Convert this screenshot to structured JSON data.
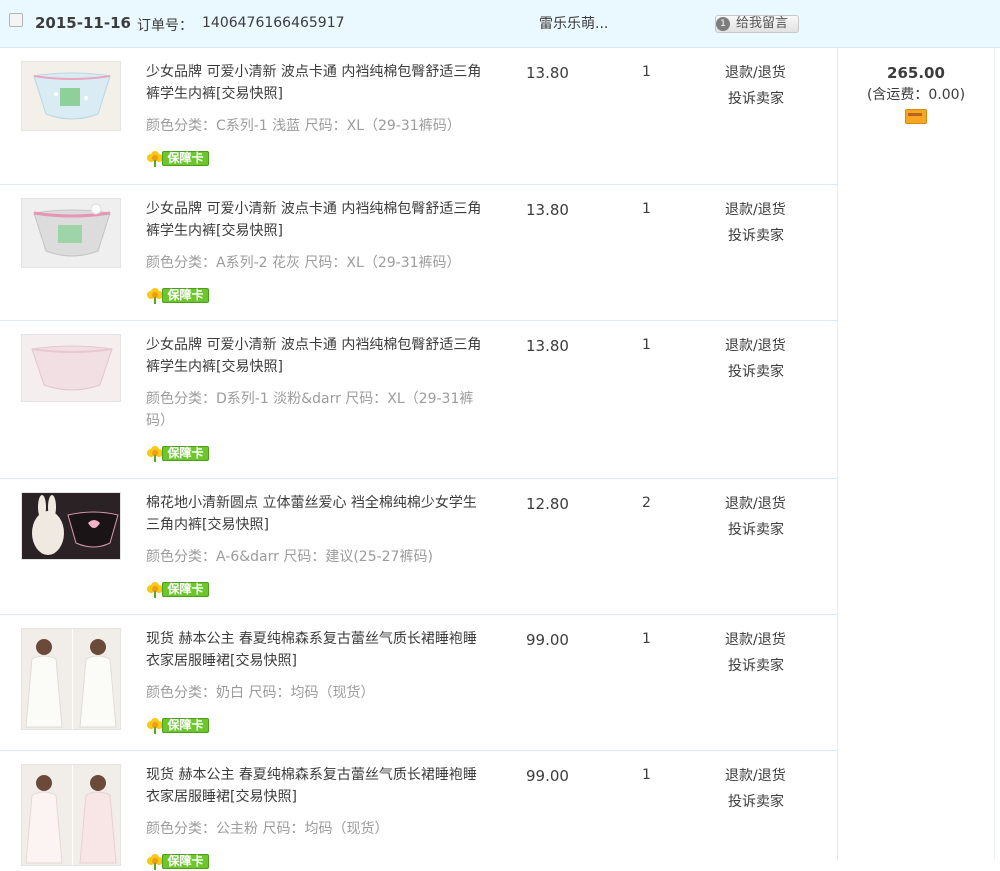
{
  "order": {
    "date": "2015-11-16",
    "number_label": "订单号：",
    "number": "1406476166465917",
    "shop": "雷乐乐萌...",
    "message_icon_text": "1",
    "message_button": "给我留言"
  },
  "items": [
    {
      "title": "少女品牌 可爱小清新 波点卡通 内裆纯棉包臀舒适三角裤学生内裤[交易快照]",
      "spec": "颜色分类：C系列-1 浅蓝  尺码：XL（29-31裤码）",
      "badge": "保障卡",
      "price": "13.80",
      "qty": "1",
      "action1": "退款/退货",
      "action2": "投诉卖家"
    },
    {
      "title": "少女品牌 可爱小清新 波点卡通 内裆纯棉包臀舒适三角裤学生内裤[交易快照]",
      "spec": "颜色分类：A系列-2 花灰  尺码：XL（29-31裤码）",
      "badge": "保障卡",
      "price": "13.80",
      "qty": "1",
      "action1": "退款/退货",
      "action2": "投诉卖家"
    },
    {
      "title": "少女品牌 可爱小清新 波点卡通 内裆纯棉包臀舒适三角裤学生内裤[交易快照]",
      "spec": "颜色分类：D系列-1 淡粉&darr  尺码：XL（29-31裤码）",
      "badge": "保障卡",
      "price": "13.80",
      "qty": "1",
      "action1": "退款/退货",
      "action2": "投诉卖家"
    },
    {
      "title": "棉花地小清新圆点 立体蕾丝爱心 裆全棉纯棉少女学生三角内裤[交易快照]",
      "spec": "颜色分类：A-6&darr  尺码：建议(25-27裤码)",
      "badge": "保障卡",
      "price": "12.80",
      "qty": "2",
      "action1": "退款/退货",
      "action2": "投诉卖家"
    },
    {
      "title": "现货 赫本公主 春夏纯棉森系复古蕾丝气质长裙睡袍睡衣家居服睡裙[交易快照]",
      "spec": "颜色分类：奶白  尺码：均码（现货）",
      "badge": "保障卡",
      "price": "99.00",
      "qty": "1",
      "action1": "退款/退货",
      "action2": "投诉卖家"
    },
    {
      "title": "现货 赫本公主 春夏纯棉森系复古蕾丝气质长裙睡袍睡衣家居服睡裙[交易快照]",
      "spec": "颜色分类：公主粉  尺码：均码（现货）",
      "badge": "保障卡",
      "price": "99.00",
      "qty": "1",
      "action1": "退款/退货",
      "action2": "投诉卖家"
    }
  ],
  "summary": {
    "total": "265.00",
    "shipping": "(含运费：0.00)"
  },
  "colors": {
    "header_bg": "#eaf8ff",
    "row_border": "#daecf7",
    "badge_green": "#6ec62e",
    "spec_gray": "#9c9c9c"
  }
}
